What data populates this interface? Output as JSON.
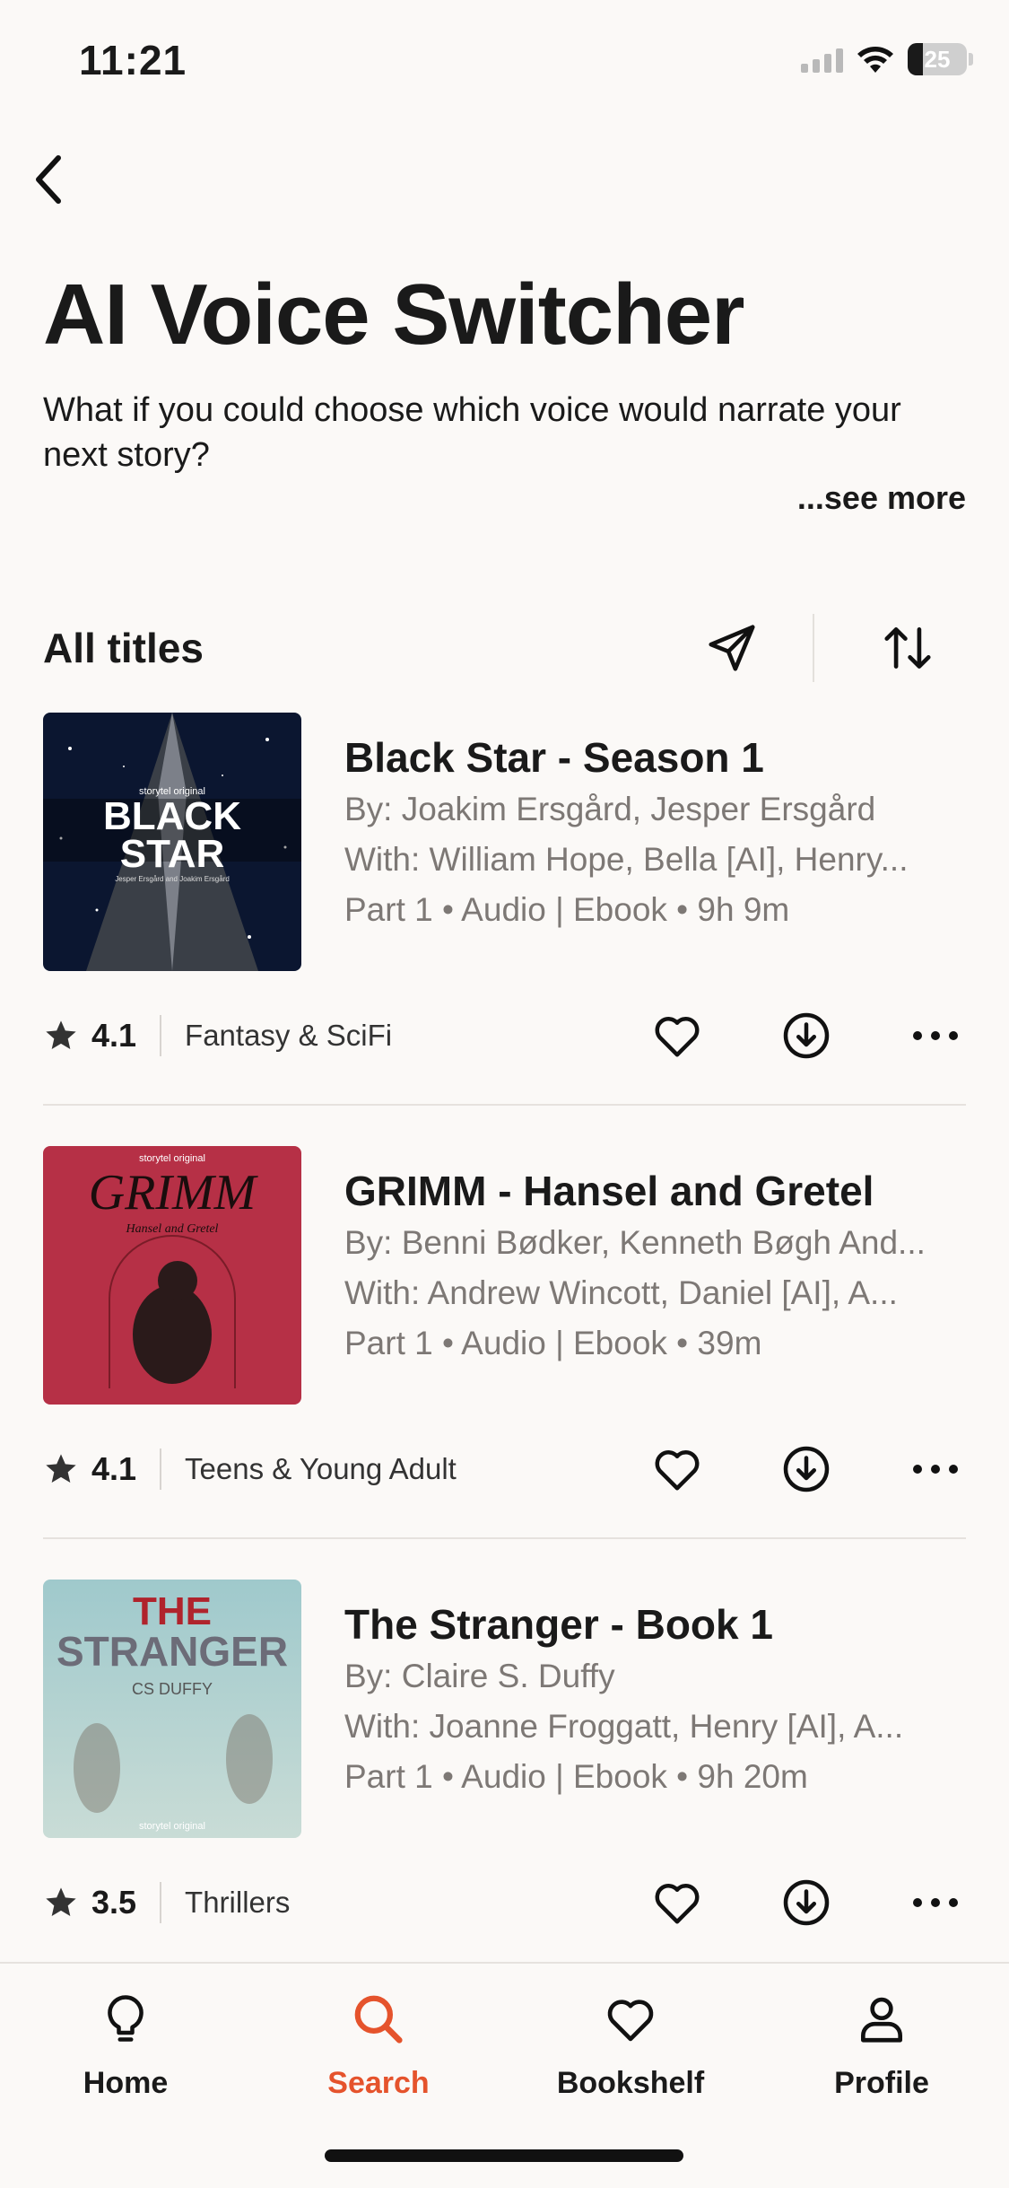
{
  "status_bar": {
    "time": "11:21",
    "battery": "25",
    "battery_level": 0.25
  },
  "page": {
    "title": "AI Voice Switcher",
    "description": "What if you could choose which voice would narrate your next story?",
    "see_more": "...see more"
  },
  "list": {
    "title": "All titles",
    "books": [
      {
        "title": "Black Star - Season 1",
        "authors": "By: Joakim Ersgård, Jesper Ersgård",
        "narrators": "With: William Hope, Bella [AI], Henry...",
        "details": "Part 1 • Audio | Ebook • 9h 9m",
        "rating": "4.1",
        "category": "Fantasy & SciFi",
        "cover": {
          "brand": "storytel original",
          "line1": "BLACK",
          "line2": "STAR",
          "credit": "Jesper Ersgård and Joakim Ersgård"
        }
      },
      {
        "title": "GRIMM - Hansel and Gretel",
        "authors": "By: Benni Bødker, Kenneth Bøgh And...",
        "narrators": "With: Andrew Wincott, Daniel [AI], A...",
        "details": "Part 1 • Audio | Ebook • 39m",
        "rating": "4.1",
        "category": "Teens & Young Adult",
        "cover": {
          "brand": "storytel original",
          "line1": "GRIMM",
          "line2": "Hansel and Gretel"
        }
      },
      {
        "title": "The Stranger - Book 1",
        "authors": "By: Claire S. Duffy",
        "narrators": "With: Joanne Froggatt, Henry [AI], A...",
        "details": "Part 1 • Audio | Ebook • 9h 20m",
        "rating": "3.5",
        "category": "Thrillers",
        "cover": {
          "brand": "storytel original",
          "line1": "THE",
          "line2": "STRANGER",
          "author": "CS DUFFY"
        }
      }
    ]
  },
  "nav": [
    {
      "label": "Home",
      "icon": "lightbulb-icon"
    },
    {
      "label": "Search",
      "icon": "search-icon",
      "active": true
    },
    {
      "label": "Bookshelf",
      "icon": "heart-icon"
    },
    {
      "label": "Profile",
      "icon": "person-icon"
    }
  ],
  "colors": {
    "accent": "#e5532c",
    "background": "#fbf9f7",
    "muted_text": "#7d7875"
  }
}
